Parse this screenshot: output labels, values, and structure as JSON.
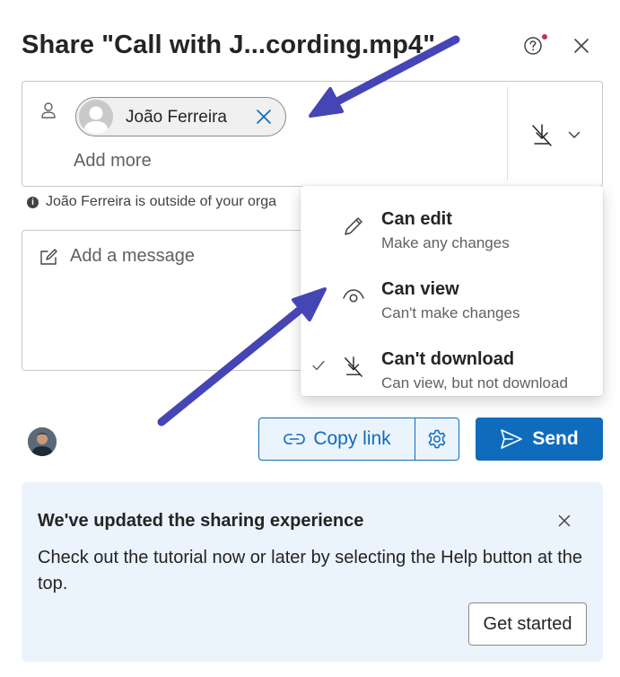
{
  "dialog": {
    "title": "Share \"Call with J...cording.mp4\"",
    "help_icon": "question-circle-icon",
    "close_icon": "dismiss-icon"
  },
  "recipients": {
    "person_icon": "person-icon",
    "chips": [
      {
        "name": "João Ferreira",
        "remove_icon": "dismiss-icon"
      }
    ],
    "add_more_placeholder": "Add more",
    "permission_icon": "no-download-icon"
  },
  "notice": {
    "icon": "info-icon",
    "text": "João Ferreira is outside of your orga"
  },
  "message": {
    "icon": "edit-note-icon",
    "placeholder": "Add a message"
  },
  "permission_menu": {
    "items": [
      {
        "title": "Can edit",
        "subtitle": "Make any changes",
        "icon": "pencil-icon",
        "selected": false
      },
      {
        "title": "Can view",
        "subtitle": "Can't make changes",
        "icon": "eye-icon",
        "selected": false
      },
      {
        "title": "Can't download",
        "subtitle": "Can view, but not download",
        "icon": "no-download-icon",
        "selected": true
      }
    ]
  },
  "actions": {
    "copy_link_label": "Copy link",
    "send_label": "Send",
    "link_icon": "link-icon",
    "settings_icon": "gear-icon",
    "send_icon": "send-icon"
  },
  "banner": {
    "title": "We've updated the sharing experience",
    "body": "Check out the tutorial now or later by selecting the Help button at the top.",
    "button_label": "Get started"
  },
  "colors": {
    "accent": "#0f6cbd",
    "banner_bg": "#ebf3fc",
    "annotation_arrow": "#4545b5"
  }
}
